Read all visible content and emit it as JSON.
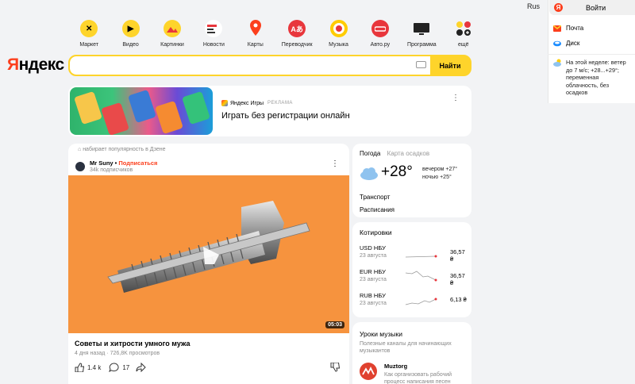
{
  "header": {
    "lang": "Rus"
  },
  "right_panel": {
    "login_label": "Войти",
    "mail_label": "Почта",
    "disk_label": "Диск",
    "weather_text": "На этой неделе: ветер до 7 м/с; +28...+29°; переменная облачность, без осадков"
  },
  "services": [
    {
      "label": "Маркет",
      "icon": "market-icon",
      "color": "#fed42b"
    },
    {
      "label": "Видео",
      "icon": "video-icon",
      "color": "#fed42b"
    },
    {
      "label": "Картинки",
      "icon": "images-icon",
      "color": "#fed42b"
    },
    {
      "label": "Новости",
      "icon": "news-icon",
      "color": "#ffffff"
    },
    {
      "label": "Карты",
      "icon": "maps-icon",
      "color": "#fc3f1d"
    },
    {
      "label": "Переводчик",
      "icon": "translate-icon",
      "color": "#fc3f1d"
    },
    {
      "label": "Музыка",
      "icon": "music-icon",
      "color": "#ffcc00"
    },
    {
      "label": "Авто.ру",
      "icon": "auto-icon",
      "color": "#e8363c"
    },
    {
      "label": "Программа",
      "icon": "tv-icon",
      "color": "#222222"
    },
    {
      "label": "ещё",
      "icon": "more-icon",
      "color": "#ffffff"
    }
  ],
  "logo": {
    "first": "Я",
    "rest": "ндекс"
  },
  "search": {
    "value": "",
    "placeholder": "",
    "button_label": "Найти"
  },
  "ad": {
    "brand": "Яндекс Игры",
    "tag": "РЕКЛАМА",
    "headline": "Играть без регистрации онлайн"
  },
  "feed": {
    "source": "набирает популярность в Дзене",
    "author": "Mr Suny",
    "subscribe": "Подписаться",
    "subscribers": "34k подписчиков",
    "duration": "05:03",
    "title": "Советы и хитрости умного мужа",
    "meta": "4 дня назад · 726,8K просмотров",
    "likes": "1.4 k",
    "comments": "17"
  },
  "weather": {
    "tab_active": "Погода",
    "tab_inactive": "Карта осадков",
    "temp": "+28°",
    "evening": "вечером +27°",
    "night": "ночью +25°",
    "link1": "Транспорт",
    "link2": "Расписания"
  },
  "rates": {
    "title": "Котировки",
    "items": [
      {
        "name": "USD НБУ",
        "date": "23 августа",
        "value": "36,57 ₴"
      },
      {
        "name": "EUR НБУ",
        "date": "23 августа",
        "value": "36,57 ₴"
      },
      {
        "name": "RUB НБУ",
        "date": "23 августа",
        "value": "6,13 ₴"
      }
    ]
  },
  "lessons": {
    "title": "Уроки музыки",
    "desc": "Полезные каналы для начинающих музыкантов",
    "channel": "Muztorg",
    "text": "Как организовать рабочий процесс написания песен"
  }
}
